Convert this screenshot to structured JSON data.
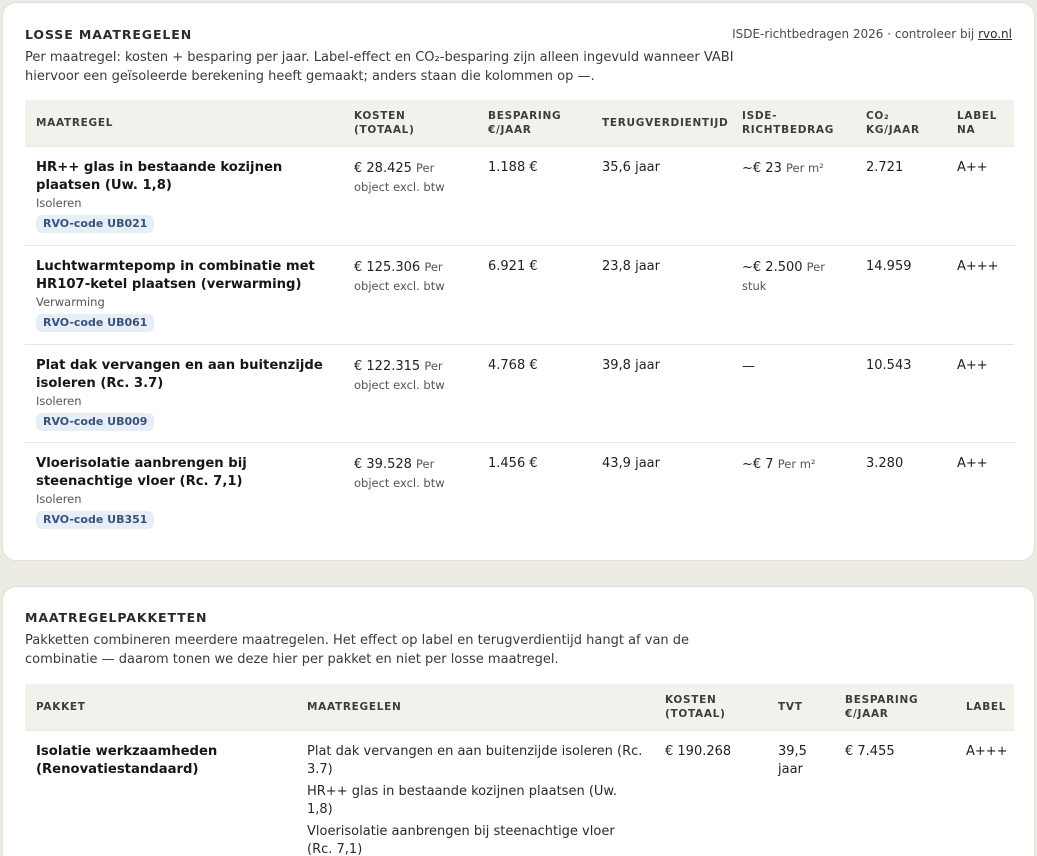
{
  "single": {
    "title": "LOSSE MAATREGELEN",
    "description": "Per maatregel: kosten + besparing per jaar. Label-effect en CO₂-besparing zijn alleen ingevuld wanneer VABI hiervoor een geïsoleerde berekening heeft gemaakt; anders staan die kolommen op —.",
    "source_prefix": "ISDE-richtbedragen 2026 · controleer bij ",
    "source_link": "rvo.nl",
    "headers": {
      "measure": "MAATREGEL",
      "cost": "KOSTEN (TOTAAL)",
      "saving": "BESPARING €/JAAR",
      "payback": "TERUGVERDIENTIJD",
      "isde": "ISDE-RICHTBEDRAG",
      "co2": "CO₂ KG/JAAR",
      "label": "LABEL NA"
    },
    "rows": [
      {
        "name": "HR++ glas in bestaande kozijnen plaatsen (Uw. 1,8)",
        "category": "Isoleren",
        "code": "RVO-code UB021",
        "cost": "€ 28.425",
        "cost_unit": "Per object excl. btw",
        "saving": "1.188 €",
        "payback": "35,6 jaar",
        "isde": "~€ 23",
        "isde_unit": "Per m²",
        "co2": "2.721",
        "label": "A++"
      },
      {
        "name": "Luchtwarmtepomp in combinatie met HR107-ketel plaatsen (verwarming)",
        "category": "Verwarming",
        "code": "RVO-code UB061",
        "cost": "€ 125.306",
        "cost_unit": "Per object excl. btw",
        "saving": "6.921 €",
        "payback": "23,8 jaar",
        "isde": "~€ 2.500",
        "isde_unit": "Per stuk",
        "co2": "14.959",
        "label": "A+++"
      },
      {
        "name": "Plat dak vervangen en aan buitenzijde isoleren (Rc. 3.7)",
        "category": "Isoleren",
        "code": "RVO-code UB009",
        "cost": "€ 122.315",
        "cost_unit": "Per object excl. btw",
        "saving": "4.768 €",
        "payback": "39,8 jaar",
        "isde": "—",
        "isde_unit": "",
        "co2": "10.543",
        "label": "A++"
      },
      {
        "name": "Vloerisolatie aanbrengen bij steenachtige vloer (Rc. 7,1)",
        "category": "Isoleren",
        "code": "RVO-code UB351",
        "cost": "€ 39.528",
        "cost_unit": "Per object excl. btw",
        "saving": "1.456 €",
        "payback": "43,9 jaar",
        "isde": "~€ 7",
        "isde_unit": "Per m²",
        "co2": "3.280",
        "label": "A++"
      }
    ]
  },
  "packages": {
    "title": "MAATREGELPAKKETTEN",
    "description": "Pakketten combineren meerdere maatregelen. Het effect op label en terugverdientijd hangt af van de combinatie — daarom tonen we deze hier per pakket en niet per losse maatregel.",
    "headers": {
      "package": "PAKKET",
      "measures": "MAATREGELEN",
      "cost": "KOSTEN (TOTAAL)",
      "tvt": "TVT",
      "saving": "BESPARING €/JAAR",
      "label": "LABEL"
    },
    "rows": [
      {
        "name": "Isolatie werkzaamheden (Renovatiestandaard)",
        "measures": [
          "Plat dak vervangen en aan buitenzijde isoleren (Rc. 3.7)",
          "HR++ glas in bestaande kozijnen plaatsen (Uw. 1,8)",
          "Vloerisolatie aanbrengen bij steenachtige vloer (Rc. 7,1)"
        ],
        "cost": "€ 190.268",
        "tvt": "39,5 jaar",
        "saving": "€ 7.455",
        "label": "A+++"
      }
    ]
  }
}
